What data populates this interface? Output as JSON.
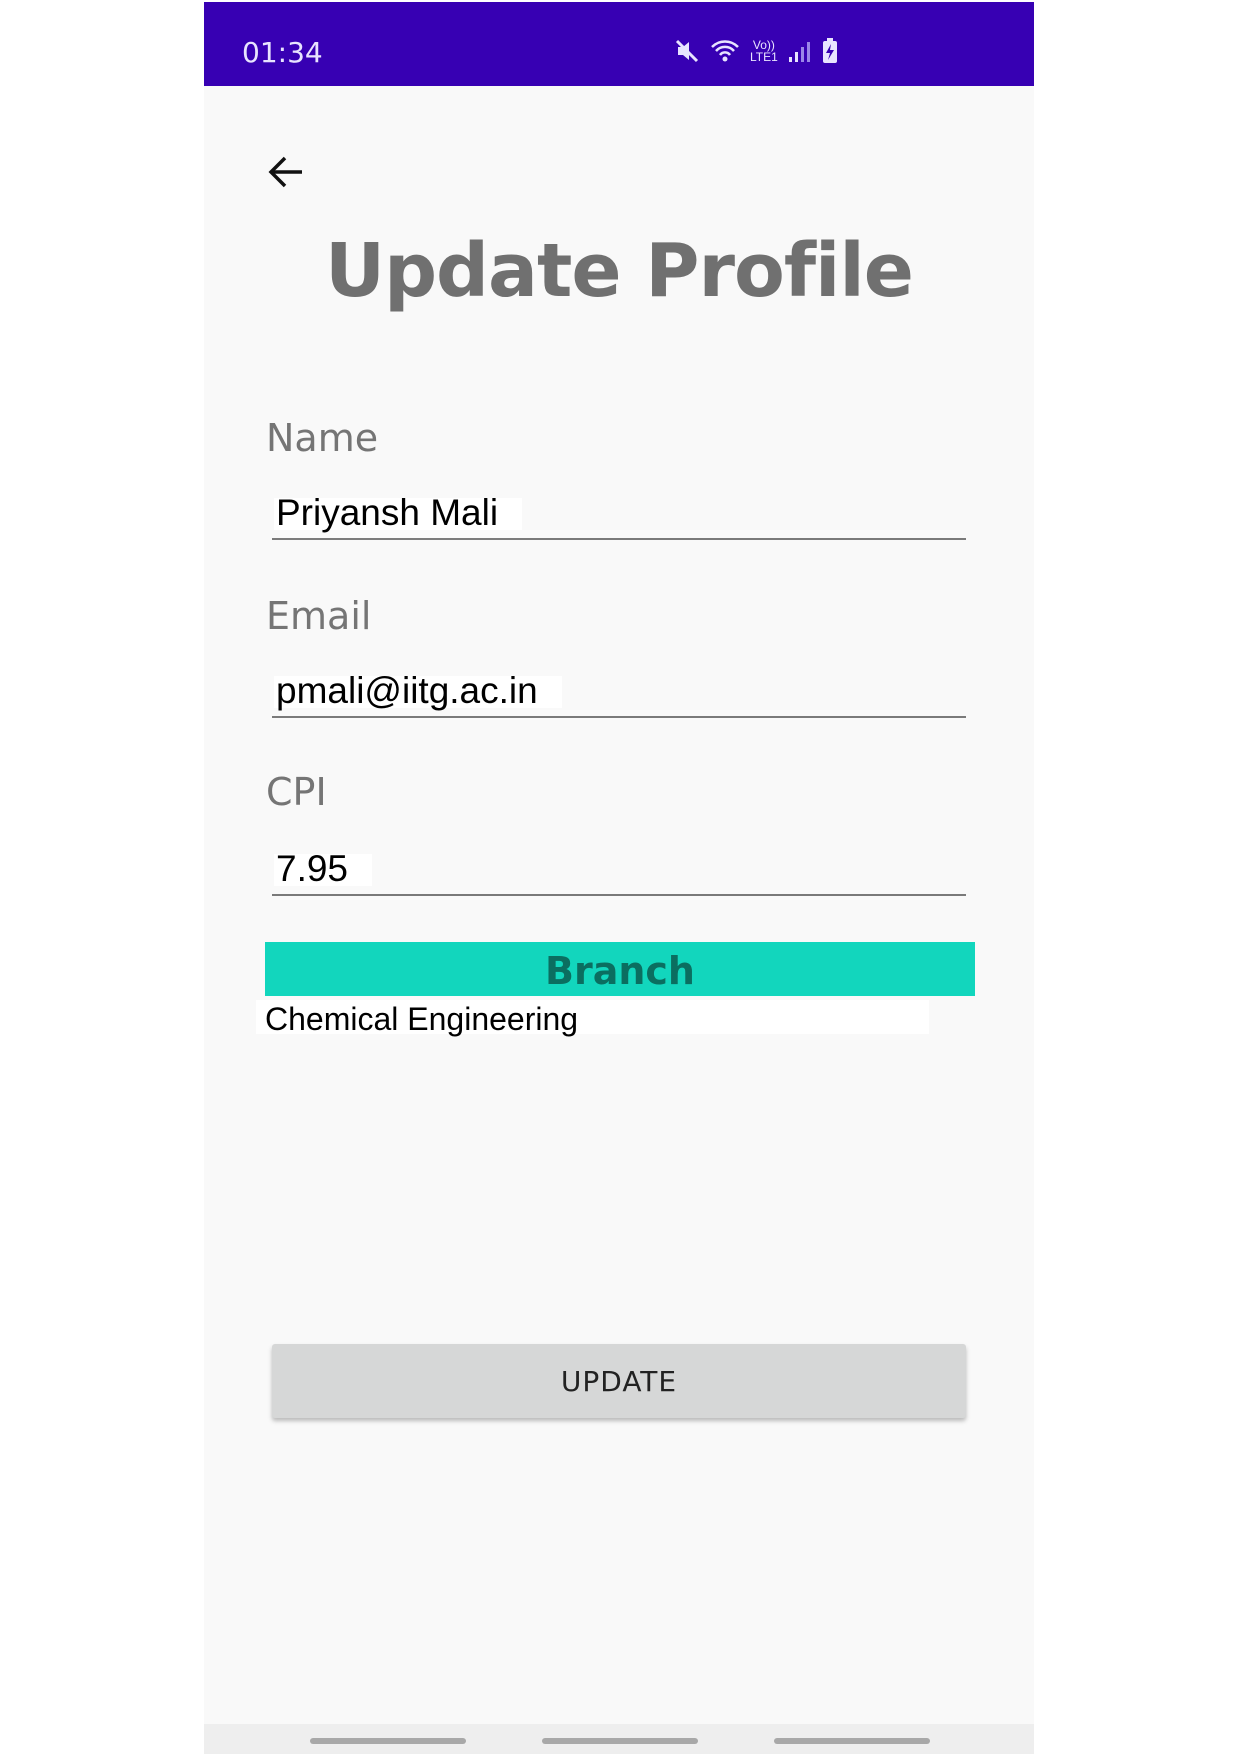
{
  "status_bar": {
    "time": "01:34",
    "network_label_top": "Vo))",
    "network_label_bottom": "LTE1"
  },
  "header": {
    "title": "Update Profile"
  },
  "form": {
    "name": {
      "label": "Name",
      "value": "Priyansh Mali"
    },
    "email": {
      "label": "Email",
      "value": "pmali@iitg.ac.in"
    },
    "cpi": {
      "label": "CPI",
      "value": "7.95"
    },
    "branch": {
      "label": "Branch",
      "selected": "Chemical Engineering"
    }
  },
  "actions": {
    "update_label": "UPDATE"
  },
  "colors": {
    "status_bar": "#3700b3",
    "branch_header": "#12d6bd",
    "button": "#d6d7d7"
  },
  "icons": [
    "mute-icon",
    "wifi-icon",
    "signal-icon",
    "battery-charging-icon",
    "arrow-back-icon"
  ]
}
